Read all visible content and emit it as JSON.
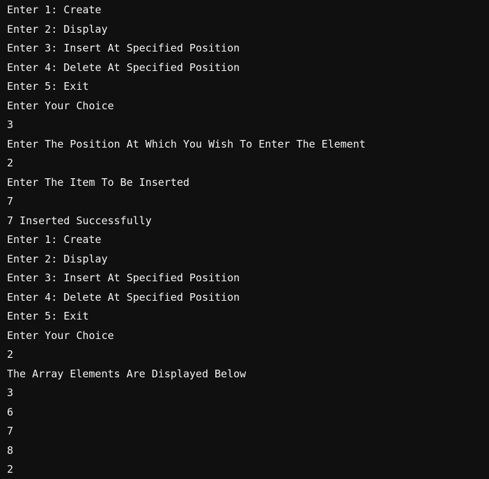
{
  "console": {
    "lines": [
      "Enter 1: Create",
      "Enter 2: Display",
      "Enter 3: Insert At Specified Position",
      "Enter 4: Delete At Specified Position",
      "Enter 5: Exit",
      "Enter Your Choice",
      "3",
      "Enter The Position At Which You Wish To Enter The Element",
      "2",
      "Enter The Item To Be Inserted",
      "7",
      "7 Inserted Successfully",
      "Enter 1: Create",
      "Enter 2: Display",
      "Enter 3: Insert At Specified Position",
      "Enter 4: Delete At Specified Position",
      "Enter 5: Exit",
      "Enter Your Choice",
      "2",
      "The Array Elements Are Displayed Below",
      "3",
      "6",
      "7",
      "8",
      "2"
    ]
  }
}
